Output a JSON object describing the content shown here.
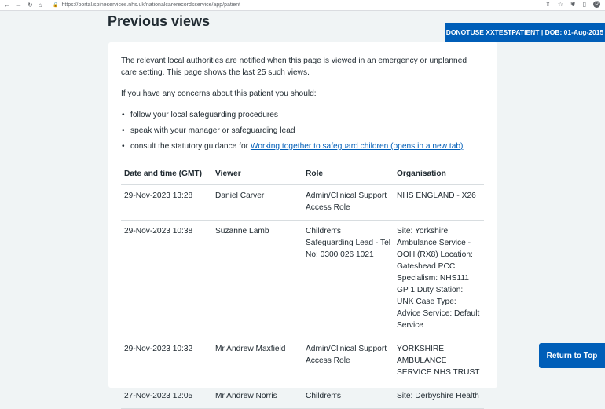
{
  "browser": {
    "url": "https://portal.spineservices.nhs.uk/nationalcarerecordsservice/app/patient",
    "avatar_letter": "D"
  },
  "banner": {
    "text": "DONOTUSE XXTESTPATIENT | DOB: 01-Aug-2015"
  },
  "page": {
    "title": "Previous views",
    "intro": "The relevant local authorities are notified when this page is viewed in an emergency or unplanned care setting. This page shows the last 25 such views.",
    "concerns_intro": "If you have any concerns about this patient you should:",
    "bullets": [
      "follow your local safeguarding procedures",
      "speak with your manager or safeguarding lead"
    ],
    "bullet3_prefix": "consult the statutory guidance for ",
    "bullet3_link": "Working together to safeguard children (opens in a new tab)"
  },
  "table": {
    "headers": [
      "Date and time (GMT)",
      "Viewer",
      "Role",
      "Organisation"
    ],
    "rows": [
      [
        "29-Nov-2023 13:28",
        "Daniel Carver",
        "Admin/Clinical Support Access Role",
        "NHS ENGLAND - X26"
      ],
      [
        "29-Nov-2023 10:38",
        "Suzanne Lamb",
        "Children's Safeguarding Lead - Tel No: 0300 026 1021",
        "Site: Yorkshire Ambulance Service - OOH (RX8) Location: Gateshead PCC Specialism: NHS111 GP 1 Duty Station: UNK Case Type: Advice Service: Default Service"
      ],
      [
        "29-Nov-2023 10:32",
        "Mr Andrew Maxfield",
        "Admin/Clinical Support Access Role",
        "YORKSHIRE AMBULANCE SERVICE NHS TRUST"
      ],
      [
        "27-Nov-2023 12:05",
        "Mr Andrew Norris",
        "Children's",
        "Site: Derbyshire Health"
      ]
    ]
  },
  "back_to_top": "Return to Top"
}
